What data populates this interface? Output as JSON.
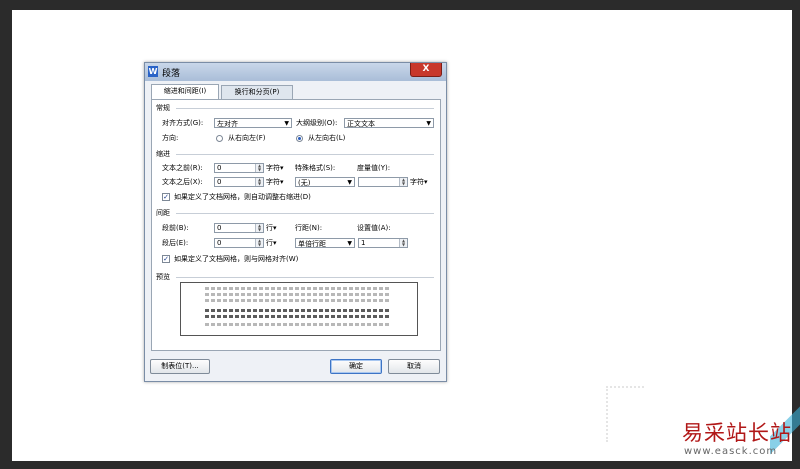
{
  "dialog": {
    "title": "段落",
    "app_icon": "W",
    "close_label": "X",
    "tabs": [
      "缩进和间距(I)",
      "换行和分页(P)"
    ],
    "general": {
      "group_label": "常规",
      "align_label": "对齐方式(G):",
      "align_value": "左对齐",
      "outline_label": "大纲级别(O):",
      "outline_value": "正文文本",
      "direction_label": "方向:",
      "rtl_label": "从右向左(F)",
      "ltr_label": "从左向右(L)"
    },
    "indent": {
      "group_label": "缩进",
      "before_label": "文本之前(R):",
      "before_value": "0",
      "before_unit": "字符▾",
      "after_label": "文本之后(X):",
      "after_value": "0",
      "after_unit": "字符▾",
      "special_label": "特殊格式(S):",
      "special_value": "(无)",
      "measure_label": "度量值(Y):",
      "measure_value": "",
      "measure_unit": "字符▾",
      "auto_adjust_label": "如果定义了文档网格，则自动调整右缩进(D)",
      "auto_adjust_checked": true
    },
    "spacing": {
      "group_label": "间距",
      "before_label": "段前(B):",
      "before_value": "0",
      "before_unit": "行▾",
      "after_label": "段后(E):",
      "after_value": "0",
      "after_unit": "行▾",
      "line_label": "行距(N):",
      "line_value": "单倍行距",
      "set_label": "设置值(A):",
      "set_value": "1",
      "snap_grid_label": "如果定义了文档网格，则与网格对齐(W)",
      "snap_grid_checked": true
    },
    "preview": {
      "group_label": "预览"
    },
    "buttons": {
      "tabs": "制表位(T)...",
      "ok": "确定",
      "cancel": "取消"
    }
  },
  "watermark": {
    "site_name": "易采站长站",
    "url": "www.easck.com"
  },
  "colors": {
    "watermark": "#b11717",
    "accent": "#2b5dbd"
  }
}
